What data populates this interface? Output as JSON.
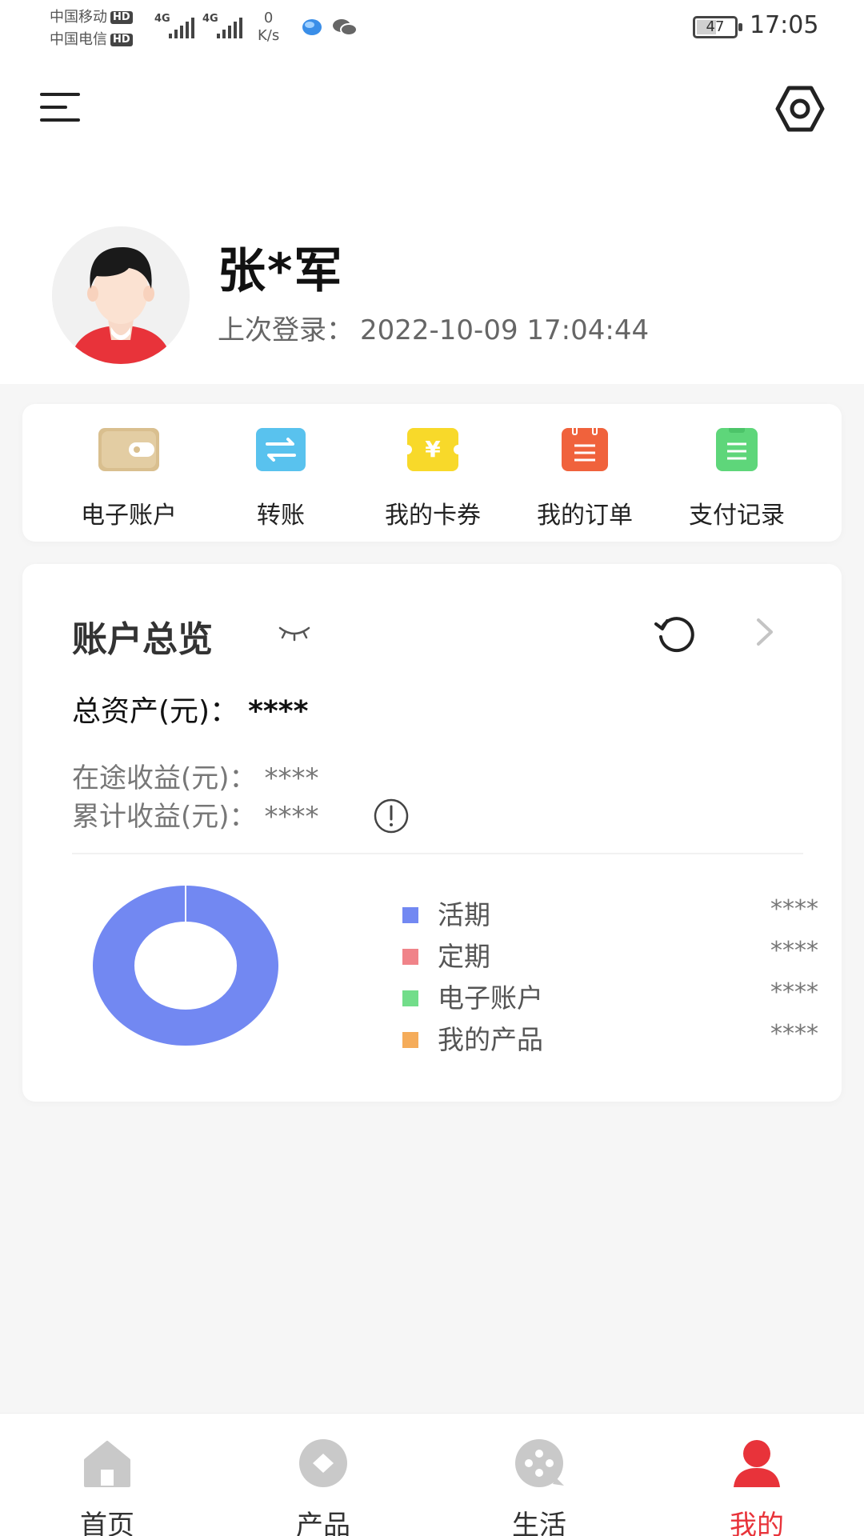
{
  "status_bar": {
    "carrier_1": "中国移动",
    "carrier_2": "中国电信",
    "hd_badge": "HD",
    "network_1": "4G",
    "network_2": "4G",
    "speed_value": "0",
    "speed_unit": "K/s",
    "battery_level": "47",
    "time": "17:05"
  },
  "header": {
    "menu_icon": "hamburger-menu-icon",
    "settings_icon": "hexagon-settings-icon"
  },
  "profile": {
    "name": "张*军",
    "last_login_label": "上次登录：",
    "last_login_time": "2022-10-09 17:04:44"
  },
  "quick_actions": [
    {
      "label": "电子账户",
      "icon": "wallet-icon",
      "color": "#d9bf8f"
    },
    {
      "label": "转账",
      "icon": "transfer-icon",
      "color": "#59c2ee"
    },
    {
      "label": "我的卡券",
      "icon": "coupon-icon",
      "color": "#f8d92a"
    },
    {
      "label": "我的订单",
      "icon": "order-icon",
      "color": "#f0623c"
    },
    {
      "label": "支付记录",
      "icon": "payment-record-icon",
      "color": "#5ed67a"
    }
  ],
  "overview": {
    "title": "账户总览",
    "total_label": "总资产(元)：",
    "total_value": "****",
    "in_transit_label": "在途收益(元)：",
    "in_transit_value": "****",
    "cumulative_label": "累计收益(元)：",
    "cumulative_value": "****",
    "legend": [
      {
        "label": "活期",
        "value": "****",
        "color": "#7288f2"
      },
      {
        "label": "定期",
        "value": "****",
        "color": "#f08389"
      },
      {
        "label": "电子账户",
        "value": "****",
        "color": "#72dd8a"
      },
      {
        "label": "我的产品",
        "value": "****",
        "color": "#f5ac5a"
      }
    ],
    "donut_fill_color": "#7288f2"
  },
  "bottom_nav": [
    {
      "label": "首页",
      "icon": "home-icon",
      "active": false
    },
    {
      "label": "产品",
      "icon": "product-icon",
      "active": false
    },
    {
      "label": "生活",
      "icon": "life-icon",
      "active": false
    },
    {
      "label": "我的",
      "icon": "profile-icon",
      "active": true
    }
  ],
  "colors": {
    "accent_red": "#e8333a",
    "inactive_icon": "#c9c9c9"
  }
}
